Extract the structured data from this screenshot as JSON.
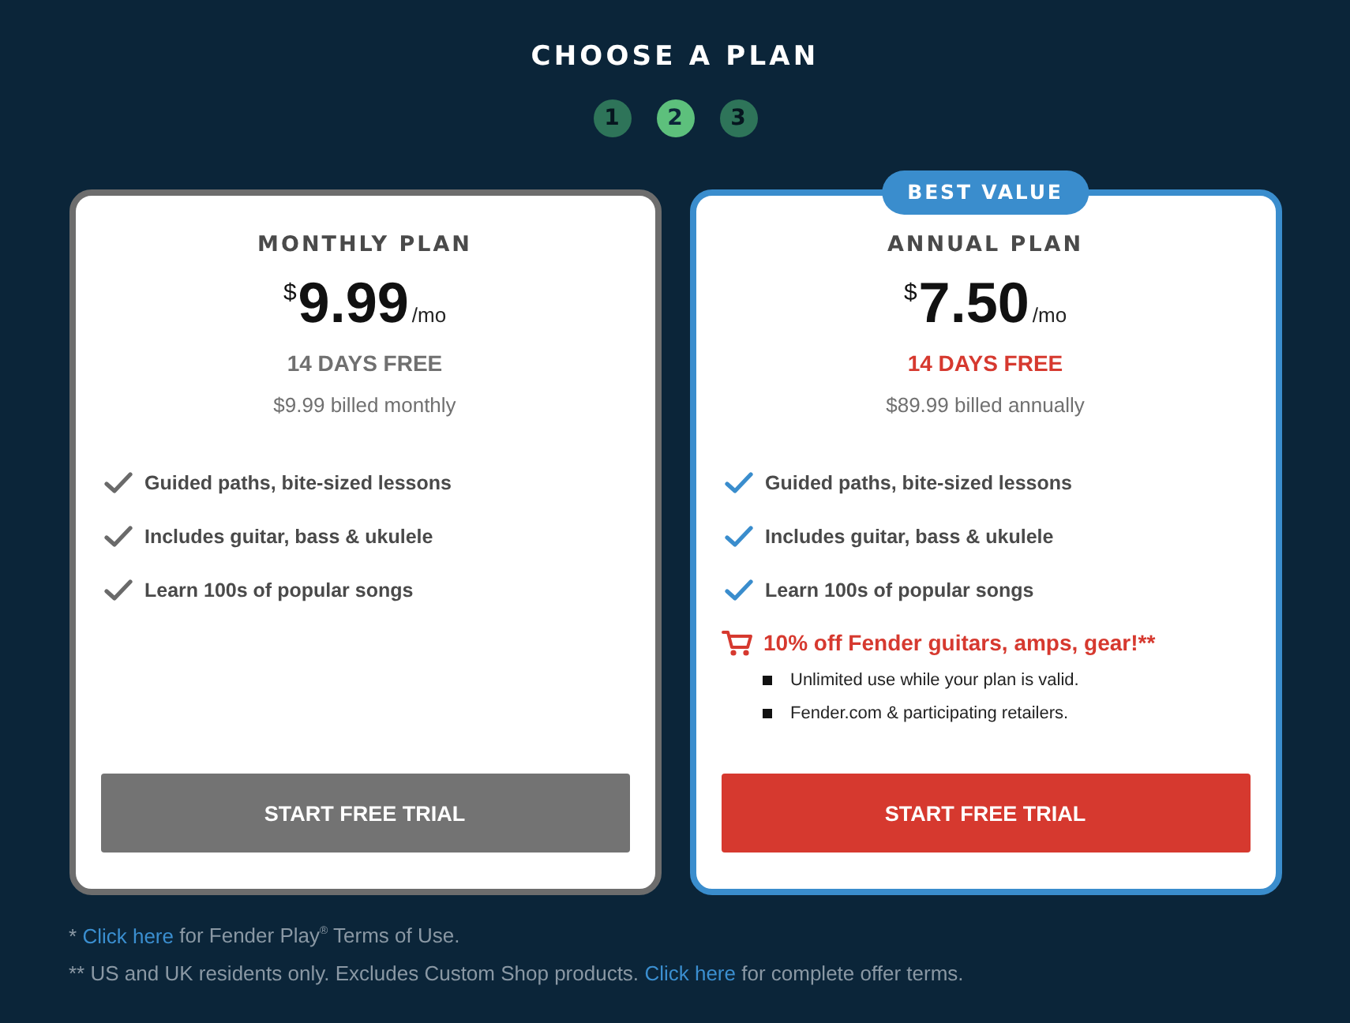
{
  "title": "CHOOSE A PLAN",
  "steps": [
    {
      "label": "1",
      "selected": false
    },
    {
      "label": "2",
      "selected": true
    },
    {
      "label": "3",
      "selected": false
    }
  ],
  "plans": [
    {
      "featured": false,
      "title": "MONTHLY PLAN",
      "currency": "$",
      "price": "9.99",
      "period": "/mo",
      "trial": "14 DAYS FREE",
      "billing": "$9.99 billed monthly",
      "features": [
        "Guided paths, bite-sized lessons",
        "Includes guitar, bass & ukulele",
        "Learn 100s of popular songs"
      ],
      "button": "START FREE TRIAL"
    },
    {
      "featured": true,
      "badge": "BEST VALUE",
      "title": "ANNUAL PLAN",
      "currency": "$",
      "price": "7.50",
      "period": "/mo",
      "trial": "14 DAYS FREE",
      "billing": "$89.99 billed annually",
      "features": [
        "Guided paths, bite-sized lessons",
        "Includes guitar, bass & ukulele",
        "Learn 100s of popular songs"
      ],
      "promo": {
        "text": "10% off Fender guitars, amps, gear!**",
        "details": [
          "Unlimited use while your plan is valid.",
          "Fender.com & participating retailers."
        ]
      },
      "button": "START FREE TRIAL"
    }
  ],
  "footnotes": [
    [
      {
        "kind": "text",
        "text": "*"
      },
      {
        "kind": "link",
        "text": "Click here"
      },
      {
        "kind": "text",
        "text": "for Fender Play$^{®}$ Terms of Use."
      }
    ],
    [
      {
        "kind": "text",
        "text": "** US and UK residents only. Excludes Custom Shop products."
      },
      {
        "kind": "link",
        "text": "Click here"
      },
      {
        "kind": "text",
        "text": "for complete offer terms."
      }
    ]
  ]
}
